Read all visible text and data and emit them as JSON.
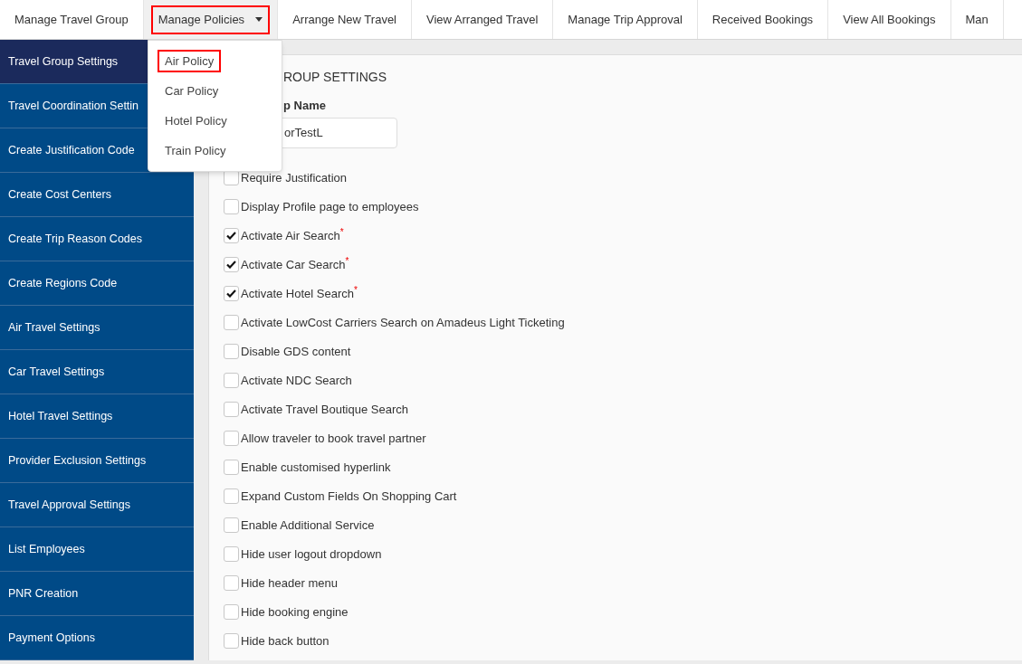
{
  "top_nav": [
    {
      "label": "Manage Travel Group",
      "selected": false,
      "highlighted": false,
      "has_caret": false
    },
    {
      "label": "Manage Policies",
      "selected": true,
      "highlighted": true,
      "has_caret": true
    },
    {
      "label": "Arrange New Travel",
      "selected": false,
      "highlighted": false,
      "has_caret": false
    },
    {
      "label": "View Arranged Travel",
      "selected": false,
      "highlighted": false,
      "has_caret": false
    },
    {
      "label": "Manage Trip Approval",
      "selected": false,
      "highlighted": false,
      "has_caret": false
    },
    {
      "label": "Received Bookings",
      "selected": false,
      "highlighted": false,
      "has_caret": false
    },
    {
      "label": "View All Bookings",
      "selected": false,
      "highlighted": false,
      "has_caret": false
    },
    {
      "label": "Man",
      "selected": false,
      "highlighted": false,
      "has_caret": false
    }
  ],
  "dropdown": {
    "items": [
      {
        "label": "Air Policy",
        "highlighted": true
      },
      {
        "label": "Car Policy",
        "highlighted": false
      },
      {
        "label": "Hotel Policy",
        "highlighted": false
      },
      {
        "label": "Train Policy",
        "highlighted": false
      }
    ]
  },
  "sidebar": {
    "items": [
      {
        "label": "Travel Group Settings",
        "selected": true
      },
      {
        "label": "Travel Coordination Settin",
        "selected": false
      },
      {
        "label": "Create Justification Code",
        "selected": false
      },
      {
        "label": "Create Cost Centers",
        "selected": false
      },
      {
        "label": "Create Trip Reason Codes",
        "selected": false
      },
      {
        "label": "Create Regions Code",
        "selected": false
      },
      {
        "label": "Air Travel Settings",
        "selected": false
      },
      {
        "label": "Car Travel Settings",
        "selected": false
      },
      {
        "label": "Hotel Travel Settings",
        "selected": false
      },
      {
        "label": "Provider Exclusion Settings",
        "selected": false
      },
      {
        "label": "Travel Approval Settings",
        "selected": false
      },
      {
        "label": "List Employees",
        "selected": false
      },
      {
        "label": "PNR Creation",
        "selected": false
      },
      {
        "label": "Payment Options",
        "selected": false
      }
    ]
  },
  "panel": {
    "title": "ROUP SETTINGS",
    "name_label": "p Name",
    "name_value": "orTestL",
    "options": [
      {
        "label": "Require Justification",
        "checked": false
      },
      {
        "label": "Display Profile page to employees",
        "checked": false
      },
      {
        "label": "Activate Air Search",
        "checked": true,
        "marker": "*"
      },
      {
        "label": "Activate Car Search",
        "checked": true,
        "marker": "*"
      },
      {
        "label": "Activate Hotel Search",
        "checked": true,
        "marker": "*"
      },
      {
        "label": "Activate LowCost Carriers Search on Amadeus Light Ticketing",
        "checked": false
      },
      {
        "label": "Disable GDS content",
        "checked": false
      },
      {
        "label": "Activate NDC Search",
        "checked": false
      },
      {
        "label": "Activate Travel Boutique Search",
        "checked": false
      },
      {
        "label": "Allow traveler to book travel partner",
        "checked": false
      },
      {
        "label": "Enable customised hyperlink",
        "checked": false
      },
      {
        "label": "Expand Custom Fields On Shopping Cart",
        "checked": false
      },
      {
        "label": "Enable Additional Service",
        "checked": false
      },
      {
        "label": "Hide user logout dropdown",
        "checked": false
      },
      {
        "label": "Hide header menu",
        "checked": false
      },
      {
        "label": "Hide booking engine",
        "checked": false
      },
      {
        "label": "Hide back button",
        "checked": false
      }
    ]
  }
}
